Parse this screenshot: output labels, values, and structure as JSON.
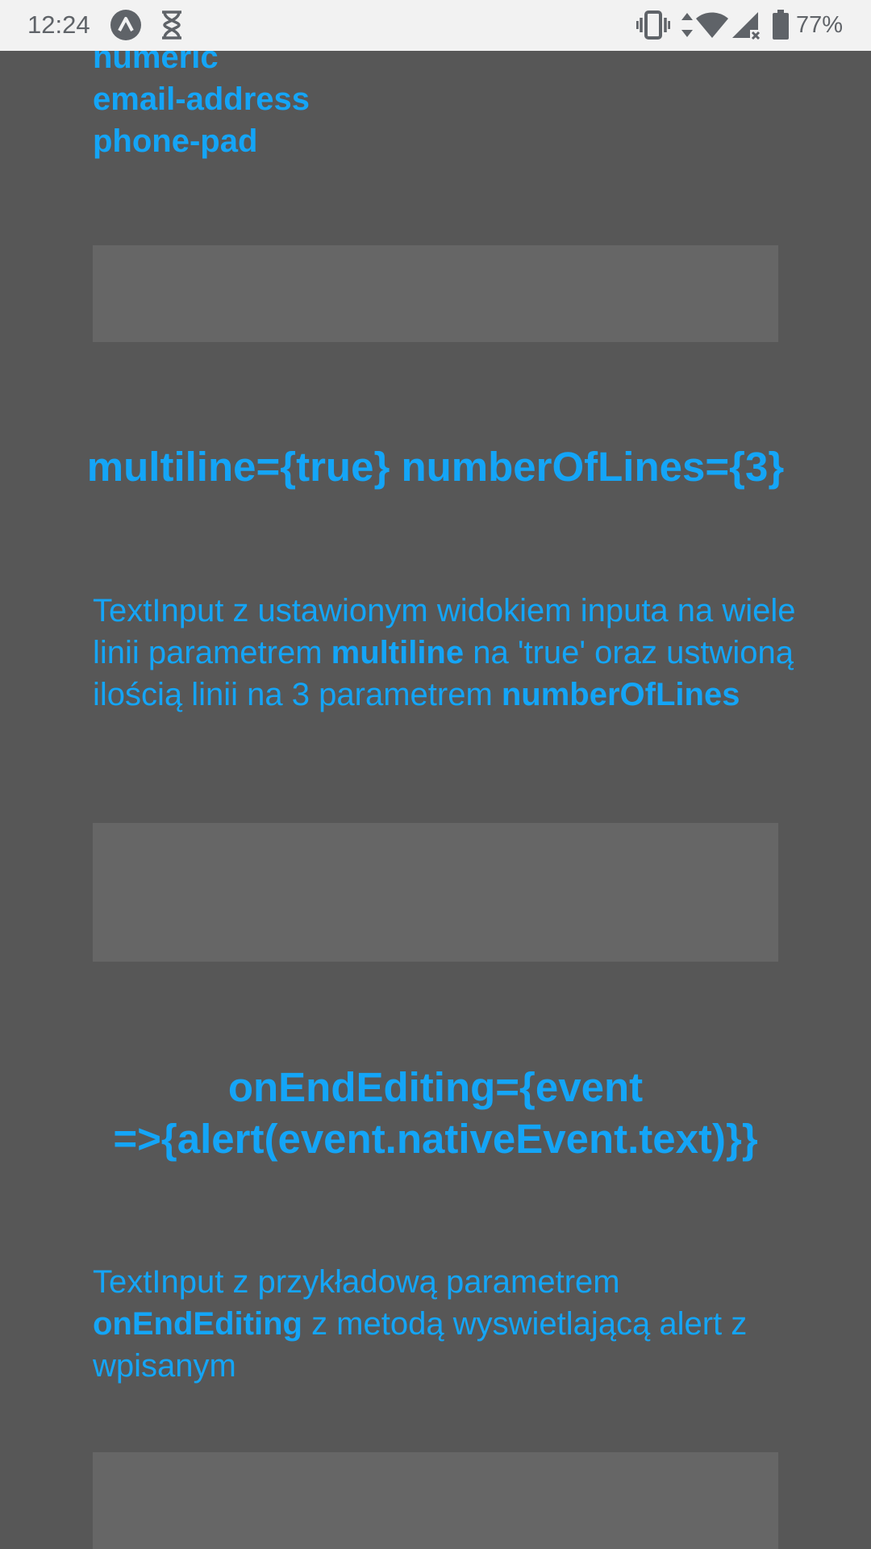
{
  "status_bar": {
    "time": "12:24",
    "icons": [
      "app-logo-icon",
      "hourglass-icon",
      "vibrate-icon",
      "data-arrows-icon",
      "wifi-icon",
      "cell-signal-icon",
      "battery-icon"
    ],
    "battery_percent": "77%"
  },
  "keyboard_types": {
    "items": [
      "numeric",
      "email-address",
      "phone-pad"
    ]
  },
  "multiline_section": {
    "title": "multiline={true} numberOfLines={3}",
    "desc_part1": "TextInput z ustawionym widokiem inputa na wiele linii parametrem ",
    "desc_bold1": "multiline",
    "desc_part2": " na 'true' oraz ustwioną ilością linii na 3 parametrem ",
    "desc_bold2": "numberOfLines"
  },
  "end_editing_section": {
    "title_line1": "onEndEditing={event",
    "title_line2": "=>{alert(event.nativeEvent.text)}}",
    "desc_part1": "TextInput z przykładową parametrem ",
    "desc_bold1": "onEndEditing",
    "desc_part2": " z metodą wyswietlającą alert z wpisanym"
  },
  "colors": {
    "background": "#575757",
    "accent_text": "#14a5f7",
    "input_background": "#666666",
    "status_bar": "#f2f2f2"
  }
}
